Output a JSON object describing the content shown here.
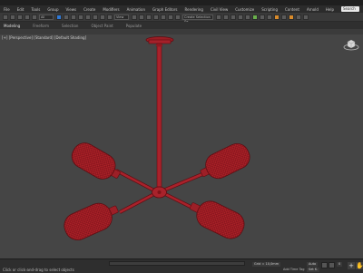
{
  "menu": {
    "items": [
      "File",
      "Edit",
      "Tools",
      "Group",
      "Views",
      "Create",
      "Modifiers",
      "Animation",
      "Graph Editors",
      "Rendering",
      "Civil View",
      "Customize",
      "Scripting",
      "Content",
      "Arnold",
      "Help"
    ],
    "search_label": "Search"
  },
  "toolbar": {
    "selection_filter": "All",
    "view_dropdown": "View",
    "selection_set_placeholder": "Create Selection Se..."
  },
  "ribbon": {
    "tabs": [
      "Modeling",
      "Freeform",
      "Selection",
      "Object Paint",
      "Populate"
    ]
  },
  "viewport": {
    "label": "[+] [Perspective] [Standard] [Default Shading]",
    "model_color": "#b0222a",
    "background_color": "#454545"
  },
  "status": {
    "text": "Click or click-and-drag to select objects",
    "grid": "Grid = 10,0mm",
    "add_time_tag": "Add Time Tag",
    "auto_key": "Auto",
    "set_key": "Set K.",
    "frame": "0"
  },
  "colors": {
    "accent": "#2f79d6",
    "menubar": "#2b2b2b",
    "toolbar": "#3a3a3a"
  }
}
